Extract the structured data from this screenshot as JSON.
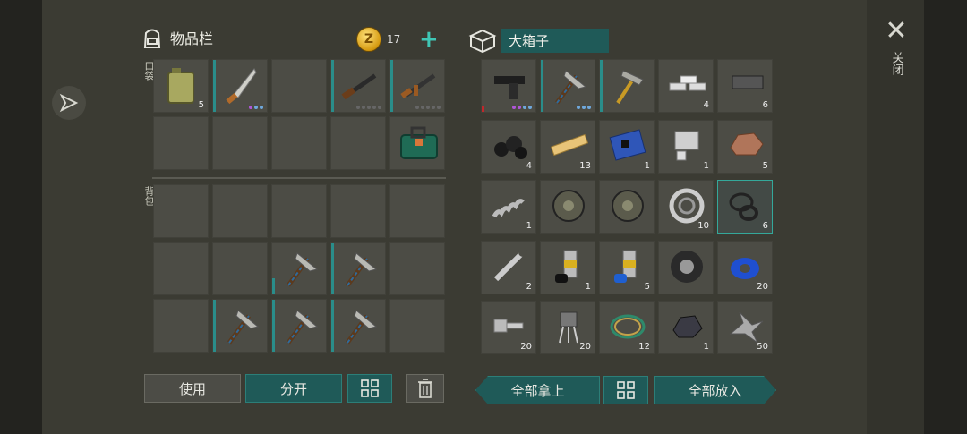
{
  "inventory": {
    "title": "物品栏",
    "coins": "17",
    "coin_symbol": "Z",
    "pocket_label": "口袋",
    "backpack_label": "背包",
    "pocket": [
      {
        "icon": "jerry-can-icon",
        "count": "5"
      },
      {
        "icon": "machete-icon",
        "dots": [
          "#b056d8",
          "#6fa8dc",
          "#6fa8dc"
        ]
      },
      {},
      {
        "icon": "shotgun-icon",
        "dots": [
          "#666",
          "#666",
          "#666",
          "#666",
          "#666"
        ]
      },
      {
        "icon": "assault-rifle-icon",
        "dots": [
          "#666",
          "#666",
          "#666",
          "#666",
          "#666"
        ]
      },
      {},
      {},
      {},
      {},
      {
        "icon": "bag-icon"
      }
    ],
    "backpack": [
      {},
      {},
      {},
      {},
      {},
      {},
      {},
      {
        "icon": "pickaxe-icon"
      },
      {
        "icon": "pickaxe-icon"
      },
      {},
      {},
      {
        "icon": "pickaxe-icon"
      },
      {
        "icon": "pickaxe-icon"
      },
      {
        "icon": "pickaxe-icon"
      },
      {}
    ]
  },
  "container": {
    "title": "大箱子",
    "items": [
      {
        "icon": "pistol-icon",
        "dots": [
          "#b056d8",
          "#b056d8",
          "#6fa8dc",
          "#6fa8dc"
        ]
      },
      {
        "icon": "pickaxe-icon",
        "dots": [
          "#6fa8dc",
          "#6fa8dc",
          "#6fa8dc"
        ]
      },
      {
        "icon": "hammer-icon"
      },
      {
        "icon": "iron-bars-icon",
        "count": "4"
      },
      {
        "icon": "steel-ingot-icon",
        "count": "6"
      },
      {
        "icon": "coal-icon",
        "count": "4"
      },
      {
        "icon": "plank-icon",
        "count": "13"
      },
      {
        "icon": "circuit-board-icon",
        "count": "1"
      },
      {
        "icon": "engine-part-icon",
        "count": "1"
      },
      {
        "icon": "ore-icon",
        "count": "5"
      },
      {
        "icon": "spring-icon",
        "count": "1"
      },
      {
        "icon": "wheel-icon"
      },
      {
        "icon": "wheel-icon"
      },
      {
        "icon": "bearing-icon",
        "count": "10"
      },
      {
        "icon": "gasket-icon",
        "count": "6"
      },
      {
        "icon": "wrench-icon",
        "count": "2"
      },
      {
        "icon": "spray-can-icon",
        "count": "1"
      },
      {
        "icon": "spray-can-blue-icon",
        "count": "5"
      },
      {
        "icon": "tire-icon"
      },
      {
        "icon": "tape-icon",
        "count": "20"
      },
      {
        "icon": "bolt-icon",
        "count": "20"
      },
      {
        "icon": "transistor-icon",
        "count": "20"
      },
      {
        "icon": "wire-icon",
        "count": "12"
      },
      {
        "icon": "rock-icon",
        "count": "1"
      },
      {
        "icon": "scrap-metal-icon",
        "count": "50"
      }
    ]
  },
  "buttons": {
    "use": "使用",
    "split": "分开",
    "take_all": "全部拿上",
    "put_all": "全部放入"
  },
  "close_label": "关闭"
}
